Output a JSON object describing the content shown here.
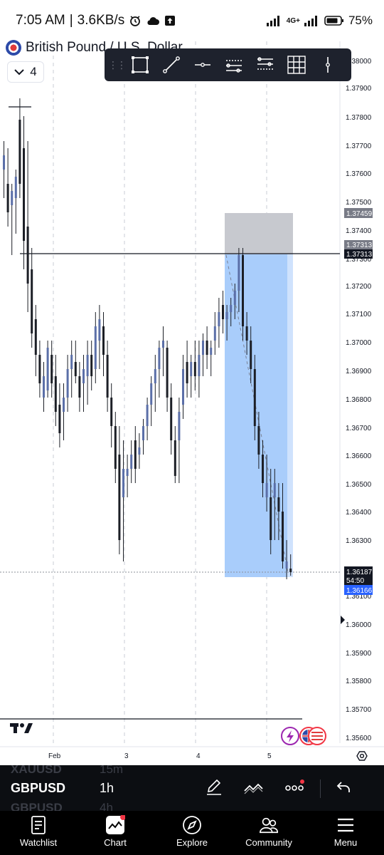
{
  "status_bar": {
    "time": "7:05 AM",
    "speed": "3.6KB/s",
    "network": "4G+",
    "battery": "75%"
  },
  "symbol": {
    "name": "British Pound / U.S. Dollar",
    "intervals_count": "4"
  },
  "price_axis": {
    "labels": [
      "1.38000",
      "1.37900",
      "1.37800",
      "1.37700",
      "1.37600",
      "1.37500",
      "1.37400",
      "1.37300",
      "1.37200",
      "1.37100",
      "1.37000",
      "1.36900",
      "1.36800",
      "1.36700",
      "1.36600",
      "1.36500",
      "1.36400",
      "1.36300",
      "1.36100",
      "1.36000",
      "1.35900",
      "1.35800",
      "1.35700",
      "1.35600"
    ],
    "badge_top": "1.37459",
    "badge_mid_a": "1.37313",
    "badge_mid_b": "1.37313",
    "badge_last": "1.36187",
    "badge_countdown": "54:50",
    "badge_low": "1.36166"
  },
  "time_axis": {
    "labels": [
      "Feb",
      "3",
      "4",
      "5"
    ]
  },
  "ticker": {
    "symbol": "GBPUSD",
    "timeframe": "1h",
    "prev_symbol": "XAUUSD",
    "prev_timeframe": "15m",
    "next_symbol": "GBPUSD",
    "next_timeframe": "4h"
  },
  "nav": {
    "watchlist": "Watchlist",
    "chart": "Chart",
    "explore": "Explore",
    "community": "Community",
    "menu": "Menu"
  },
  "colors": {
    "up_candle": "#5b6fa8",
    "down_candle": "#1c1f26",
    "profit_zone": "#a9cdfb",
    "stop_zone": "#c7c9cf",
    "accent_red": "#f23645"
  }
}
